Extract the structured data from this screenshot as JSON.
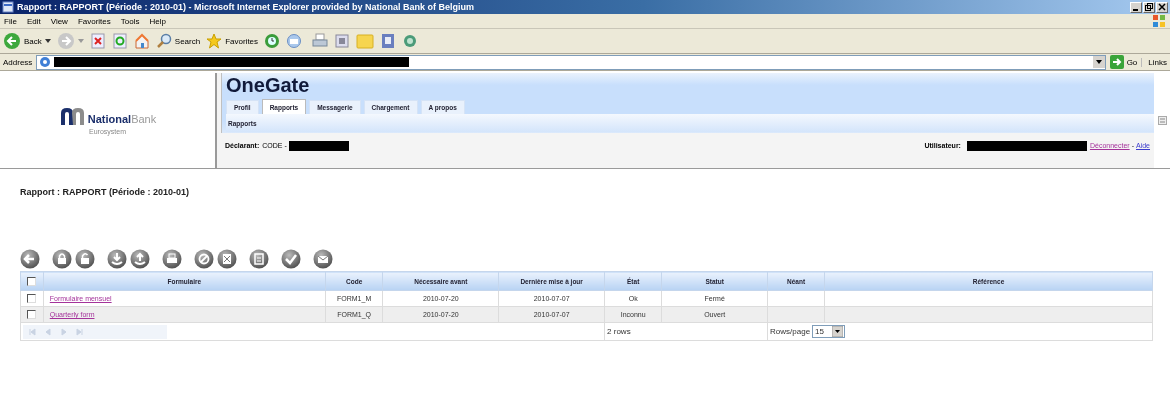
{
  "window": {
    "title": "Rapport : RAPPORT (Période : 2010-01) - Microsoft Internet Explorer provided by National Bank of Belgium"
  },
  "menu": [
    "File",
    "Edit",
    "View",
    "Favorites",
    "Tools",
    "Help"
  ],
  "browser_toolbar": {
    "back": "Back",
    "search": "Search",
    "favorites": "Favorites"
  },
  "address_bar": {
    "label": "Address",
    "go": "Go",
    "links": "Links"
  },
  "logo": {
    "name_1": "National",
    "name_2": "Bank",
    "tagline": "Eurosystem"
  },
  "app": {
    "title": "OneGate",
    "tabs": [
      {
        "label": "Profil",
        "selected": false
      },
      {
        "label": "Rapports",
        "selected": true
      },
      {
        "label": "Messagerie",
        "selected": false
      },
      {
        "label": "Chargement",
        "selected": false
      },
      {
        "label": "A propos",
        "selected": false
      }
    ],
    "subtabs": [
      {
        "label": "Rapports",
        "selected": true
      }
    ],
    "declarant": {
      "label": "Déclarant:",
      "value": "CODE -"
    },
    "user": {
      "label": "Utilisateur:",
      "logout": "Déconnecter",
      "separator": "-",
      "help": "Aide"
    }
  },
  "page_title": "Rapport : RAPPORT (Période : 2010-01)",
  "table": {
    "select_all_checked": false,
    "columns": [
      "Formulaire",
      "Code",
      "Nécessaire avant",
      "Dernière mise à jour",
      "État",
      "Statut",
      "Néant",
      "Référence"
    ],
    "rows": [
      {
        "checked": false,
        "cells": [
          "Formulaire mensuel",
          "FORM1_M",
          "2010-07-20",
          "2010-07-07",
          "Ok",
          "Fermé",
          "",
          ""
        ]
      },
      {
        "checked": false,
        "cells": [
          "Quarterly form",
          "FORM1_Q",
          "2010-07-20",
          "2010-07-07",
          "Inconnu",
          "Ouvert",
          "",
          ""
        ]
      }
    ],
    "row_count": "2 rows",
    "rows_per_page_label": "Rows/page",
    "rows_per_page": "15"
  }
}
